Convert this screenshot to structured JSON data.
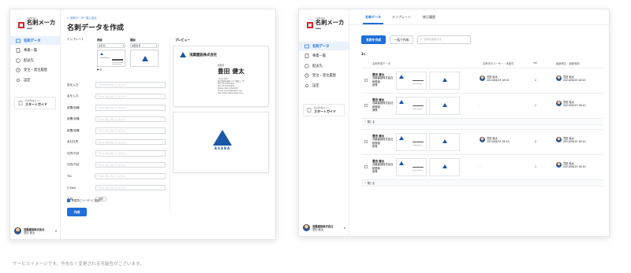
{
  "brand": {
    "small": "CANVAS",
    "big": "名刺メーカー",
    "accent": "#1e6fd9",
    "logo_color": "#d6252b"
  },
  "sidebar": {
    "items": [
      {
        "label": "名刺データ",
        "icon": "card-icon"
      },
      {
        "label": "事業一覧",
        "icon": "document-icon"
      },
      {
        "label": "配送先",
        "icon": "location-icon"
      },
      {
        "label": "受注・発注履歴",
        "icon": "history-icon"
      },
      {
        "label": "設定",
        "icon": "gear-icon"
      }
    ],
    "guide": {
      "small": "名刺作成ガイド",
      "big": "スタートガイド"
    },
    "account": {
      "company": "浅葉建設株式会社",
      "name": "豊田 健太"
    }
  },
  "left": {
    "breadcrumb": "← 名刺データ一覧に戻る",
    "title": "名刺データを作成",
    "template_label": "テンプレート",
    "front": {
      "title": "表面",
      "select": "表名刺",
      "radio": "● 白"
    },
    "back": {
      "title": "裏面",
      "select": "裏面名刺"
    },
    "fields": [
      {
        "label": "姓を入力",
        "placeholder": "テキストを入力してください"
      },
      {
        "label": "名を入力",
        "placeholder": "テキストを入力してください"
      },
      {
        "label": "部署/役職",
        "placeholder": "テキストを入力してください"
      },
      {
        "label": "部署/役職",
        "placeholder": "テキストを入力してください"
      },
      {
        "label": "部署/役職",
        "placeholder": "テキストを入力してください"
      },
      {
        "label": "会社住所",
        "placeholder": "テキストを入力してください"
      },
      {
        "label": "住所/行目",
        "placeholder": "テキストを入力してください"
      },
      {
        "label": "住所/行目",
        "placeholder": "テキストを入力してください"
      },
      {
        "label": "TEL",
        "placeholder": "テキストを入力してください"
      },
      {
        "label": "E-Mail",
        "placeholder": "テキストを入力してください"
      }
    ],
    "photo_label": "写真",
    "photo_button": "選択",
    "checkbox": "所属員にユーザーに追加",
    "create_button": "作成",
    "preview_title": "プレビュー",
    "card": {
      "company": "浅葉建設株式会社",
      "dept": "総務部",
      "name": "豊田 健太",
      "lines": [
        "〒123-4567",
        "東京都港区浅葉1-2-3 浅葉ビル 5F",
        "TEL: 03-1234-5678",
        "FAX: 03-1234-5679",
        "Mobile: 090-1234-5678",
        "E-mail: toyoda@asaba.co.jp",
        "URL: https://www.asaba.co.jp"
      ],
      "logo_word": "ASABA"
    }
  },
  "right": {
    "tabs": [
      "名刺データ",
      "テンプレート",
      "修正履歴"
    ],
    "create_button": "名刺を作成",
    "bulk_button": "一括で作成",
    "search_placeholder": "名刺を検索する",
    "count": "2",
    "count_unit": "件",
    "headers": [
      "名刺作成データ",
      "名刺中のユーザー・未紐付",
      "Ver",
      "最新修正・最新時刻"
    ],
    "groups": [
      {
        "rows": [
          {
            "name": "豊田 健太",
            "company": "浅葉建設株式会社",
            "dept": "総務部",
            "role": "部長",
            "user_name": "豊田 健太",
            "user_date": "2021/06/23 18:10",
            "ver": "2",
            "updated_name": "豊田 健太",
            "updated_date": "2021/06/23 18:10"
          },
          {
            "name": "豊田 健太",
            "company": "浅葉建設株式会社",
            "dept": "総務部",
            "role": "課長",
            "user_name": "-",
            "user_date": "",
            "ver": "1",
            "updated_name": "豊田 健太",
            "updated_date": "2021/06/23 18:10"
          }
        ],
        "toggle": "閉じる"
      },
      {
        "rows": [
          {
            "name": "豊田 健太",
            "company": "浅葉建設株式会社",
            "dept": "総務部",
            "role": "部長",
            "user_name": "豊田 健太",
            "user_date": "2021/06/23 18:10",
            "ver": "2",
            "updated_name": "豊田 健太",
            "updated_date": "2021/06/23 18:10"
          },
          {
            "name": "豊田 健太",
            "company": "浅葉建設株式会社",
            "dept": "総務部",
            "role": "部長",
            "user_name": "-",
            "user_date": "",
            "ver": "1",
            "updated_name": "豊田 健太",
            "updated_date": "2021/06/23 18:10"
          }
        ],
        "toggle": "閉じる"
      }
    ]
  },
  "caption": "サービスイメージです。予告なく変更される可能性がございます。"
}
